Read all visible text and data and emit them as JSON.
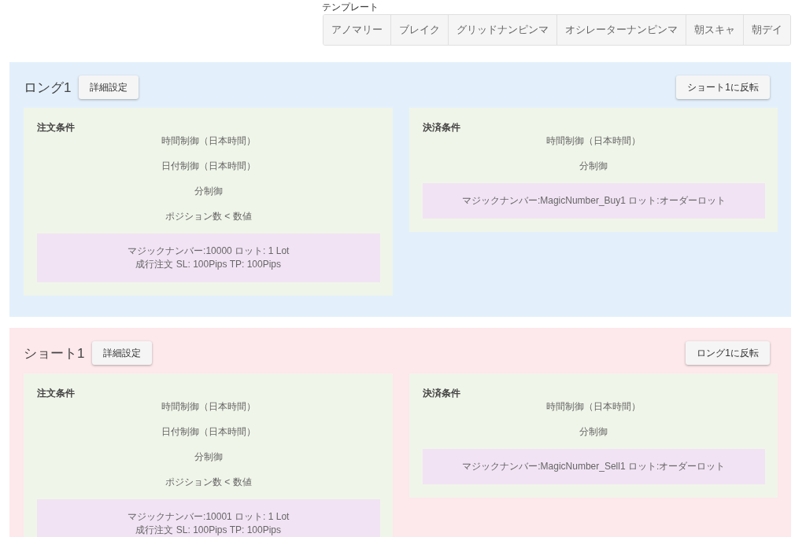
{
  "template": {
    "label": "テンプレート",
    "buttons": [
      "アノマリー",
      "ブレイク",
      "グリッドナンピンマ",
      "オシレーターナンピンマ",
      "朝スキャ",
      "朝デイ"
    ]
  },
  "sections": [
    {
      "title": "ロング1",
      "color": "#e3f0fc",
      "settings_button": "詳細設定",
      "reverse_button": "ショート1に反転",
      "cards": [
        {
          "title": "注文条件",
          "conditions": [
            "時間制御（日本時間）",
            "日付制御（日本時間）",
            "分制御",
            "ポジション数 < 数値"
          ],
          "order_lines": [
            "マジックナンバー:10000 ロット: 1 Lot",
            "成行注文 SL: 100Pips TP: 100Pips"
          ]
        },
        {
          "title": "決済条件",
          "conditions": [
            "時間制御（日本時間）",
            "分制御"
          ],
          "order_lines": [
            "マジックナンバー:MagicNumber_Buy1 ロット:オーダーロット"
          ]
        }
      ]
    },
    {
      "title": "ショート1",
      "color": "#fde8eb",
      "settings_button": "詳細設定",
      "reverse_button": "ロング1に反転",
      "cards": [
        {
          "title": "注文条件",
          "conditions": [
            "時間制御（日本時間）",
            "日付制御（日本時間）",
            "分制御",
            "ポジション数 < 数値"
          ],
          "order_lines": [
            "マジックナンバー:10001 ロット: 1 Lot",
            "成行注文 SL: 100Pips TP: 100Pips"
          ]
        },
        {
          "title": "決済条件",
          "conditions": [
            "時間制御（日本時間）",
            "分制御"
          ],
          "order_lines": [
            "マジックナンバー:MagicNumber_Sell1 ロット:オーダーロット"
          ]
        }
      ]
    }
  ]
}
